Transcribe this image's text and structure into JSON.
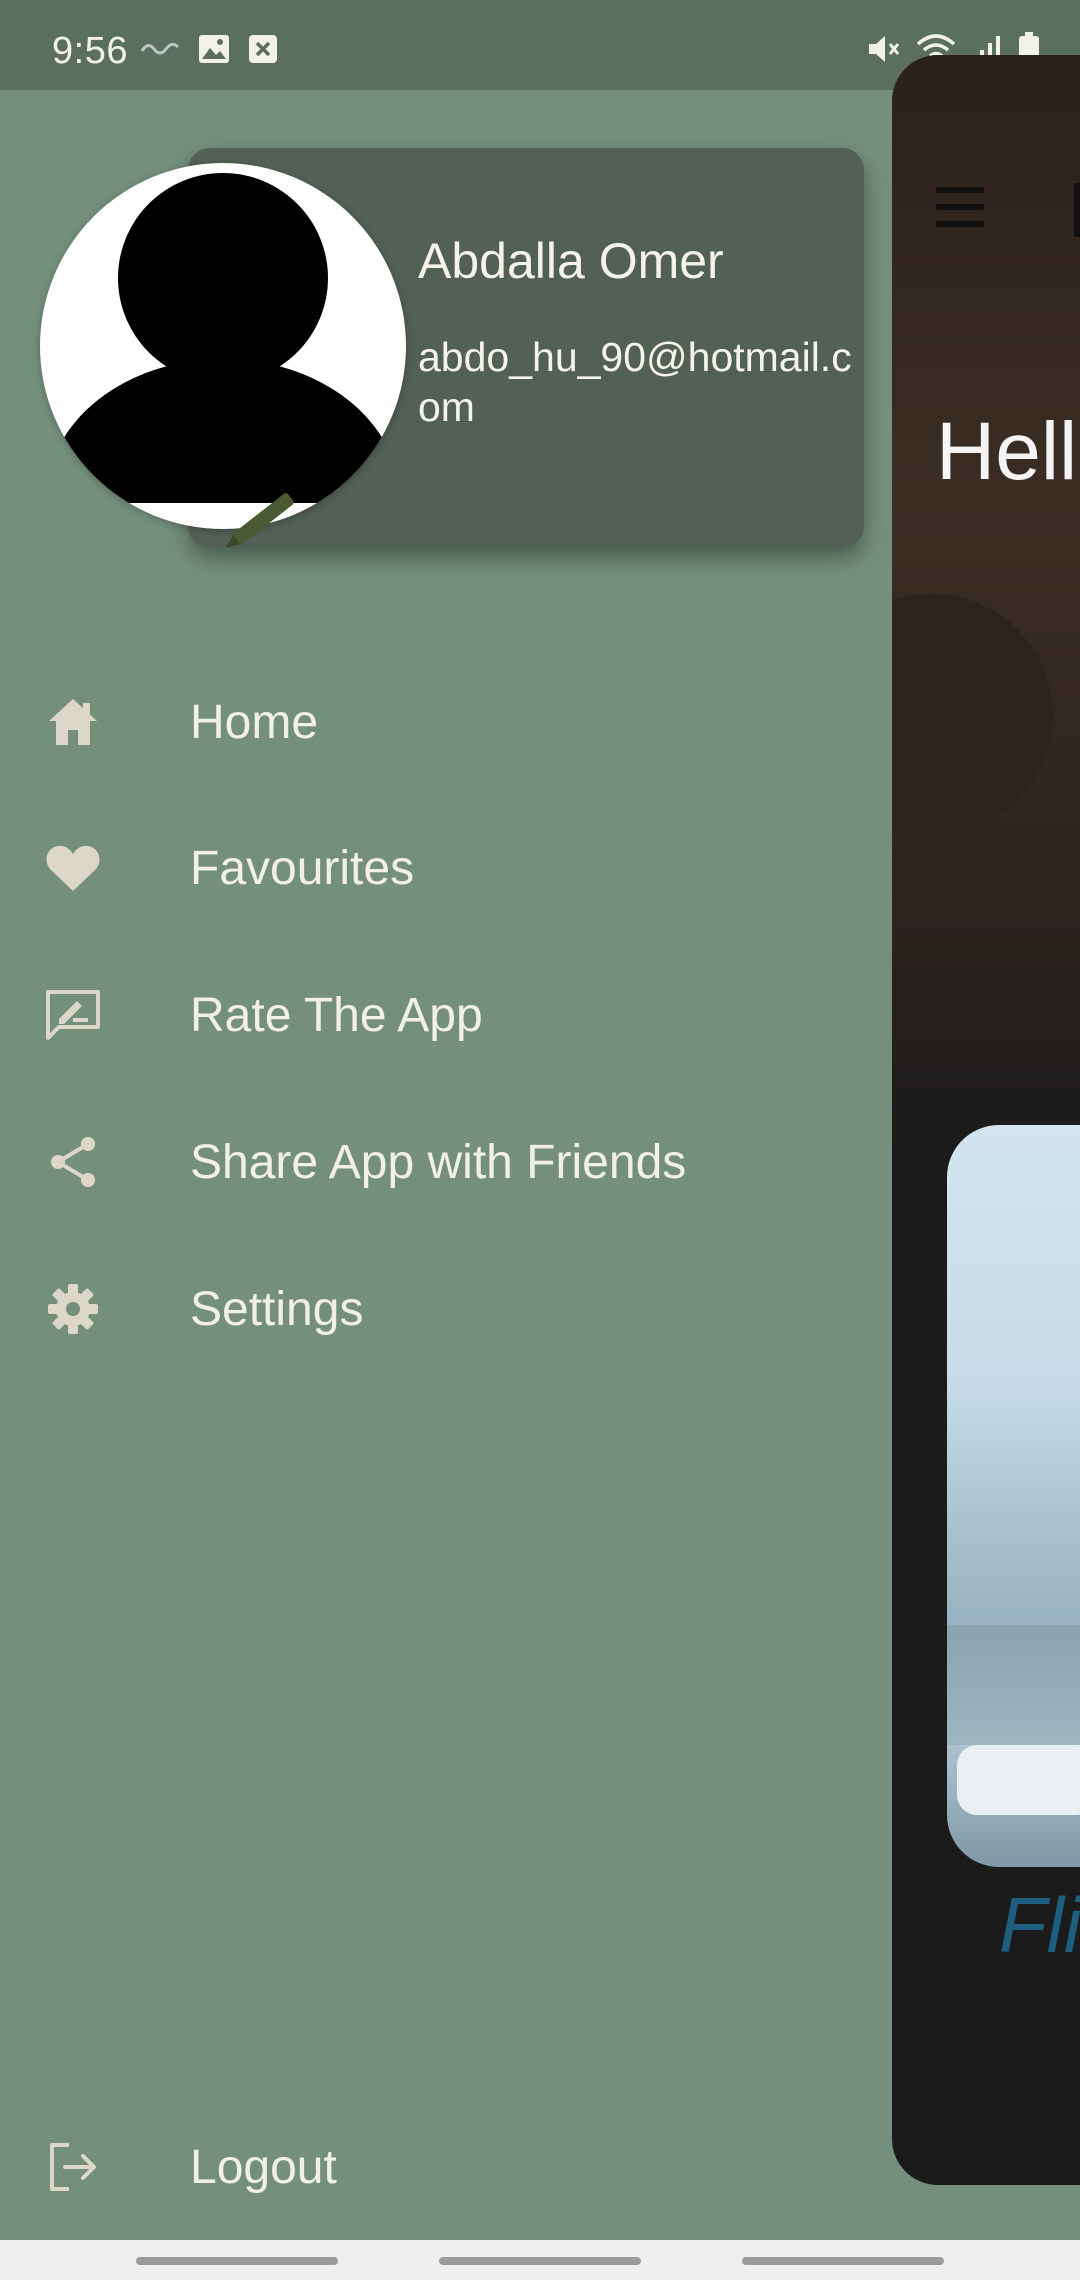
{
  "status_bar": {
    "time": "9:56",
    "left_icons": [
      "wavy-line-icon",
      "image-icon",
      "close-box-icon"
    ],
    "right_icons": [
      "mute-icon",
      "wifi-icon",
      "signal-icon",
      "battery-icon"
    ]
  },
  "profile": {
    "name": "Abdalla Omer",
    "email": "abdo_hu_90@hotmail.com",
    "avatar_icon": "person-avatar",
    "edit_icon": "pencil-icon"
  },
  "menu": {
    "items": [
      {
        "label": "Home",
        "icon": "home-icon"
      },
      {
        "label": "Favourites",
        "icon": "heart-icon"
      },
      {
        "label": "Rate The App",
        "icon": "rate-app-icon"
      },
      {
        "label": "Share App with Friends",
        "icon": "share-icon"
      },
      {
        "label": "Settings",
        "icon": "gear-icon"
      }
    ],
    "logout": {
      "label": "Logout",
      "icon": "logout-icon"
    }
  },
  "main_peek": {
    "hello_text": "Hell",
    "card_title": "Fli"
  },
  "colors": {
    "drawer_bg": "#748f7c",
    "status_bar_bg": "#5b6f61",
    "card_bg": "#526055",
    "text_light": "#f2efe6",
    "icon_color": "#dcd7c9",
    "main_bg": "#1b1b1b",
    "accent_blue": "#1e5e7e"
  }
}
